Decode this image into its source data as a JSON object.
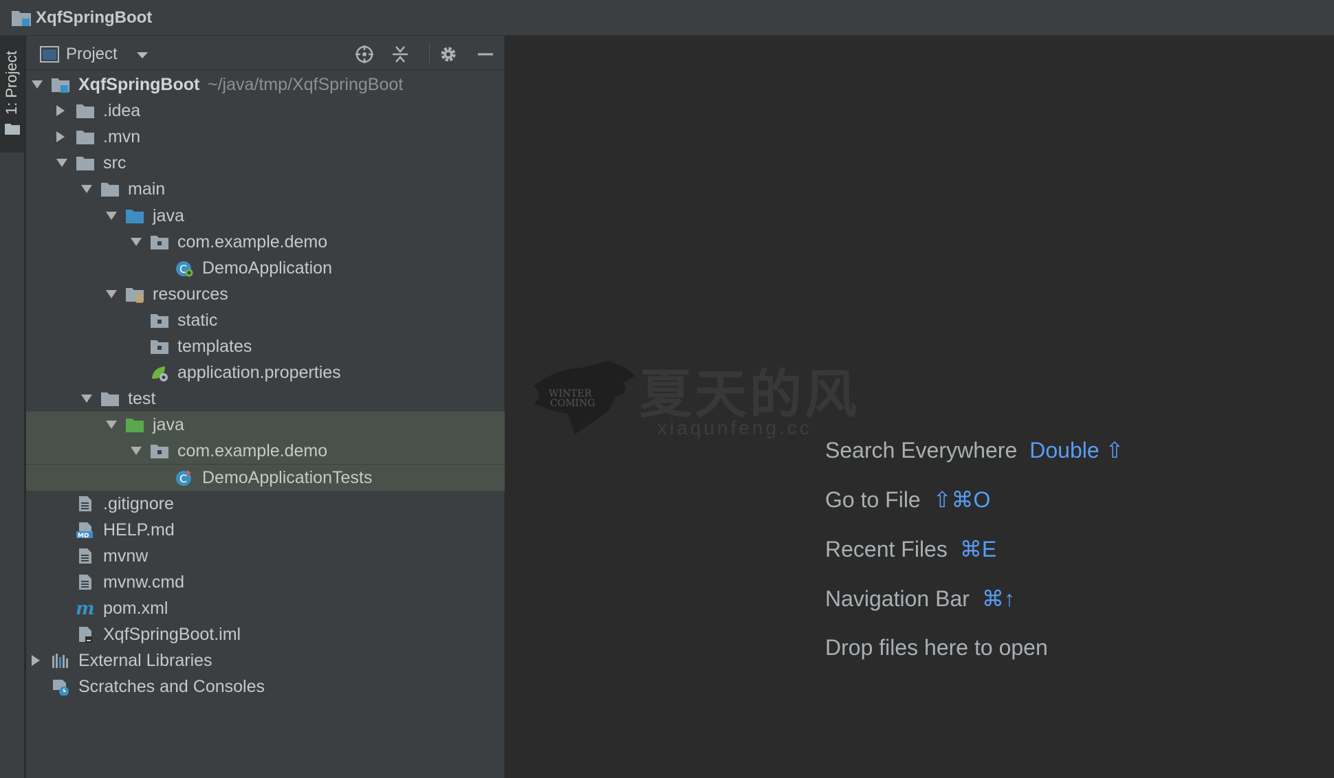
{
  "window": {
    "title": "XqfSpringBoot"
  },
  "side_strip": {
    "tab_label": "1: Project"
  },
  "panel": {
    "view_label": "Project"
  },
  "tree": [
    {
      "label": "XqfSpringBoot",
      "path": "~/java/tmp/XqfSpringBoot",
      "icon": "module-folder-icon",
      "arrow": "down",
      "depth": 0
    },
    {
      "label": ".idea",
      "icon": "folder-icon",
      "arrow": "right",
      "depth": 1
    },
    {
      "label": ".mvn",
      "icon": "folder-icon",
      "arrow": "right",
      "depth": 1
    },
    {
      "label": "src",
      "icon": "folder-icon",
      "arrow": "down",
      "depth": 1
    },
    {
      "label": "main",
      "icon": "folder-icon",
      "arrow": "down",
      "depth": 2
    },
    {
      "label": "java",
      "icon": "source-folder-icon",
      "arrow": "down",
      "depth": 3
    },
    {
      "label": "com.example.demo",
      "icon": "package-icon",
      "arrow": "down",
      "depth": 4
    },
    {
      "label": "DemoApplication",
      "icon": "spring-class-icon",
      "arrow": "none",
      "depth": 5
    },
    {
      "label": "resources",
      "icon": "resources-folder-icon",
      "arrow": "down",
      "depth": 3
    },
    {
      "label": "static",
      "icon": "package-icon",
      "arrow": "none",
      "depth": 4
    },
    {
      "label": "templates",
      "icon": "package-icon",
      "arrow": "none",
      "depth": 4
    },
    {
      "label": "application.properties",
      "icon": "spring-properties-icon",
      "arrow": "none",
      "depth": 4
    },
    {
      "label": "test",
      "icon": "folder-icon",
      "arrow": "down",
      "depth": 2
    },
    {
      "label": "java",
      "icon": "test-folder-icon",
      "arrow": "down",
      "depth": 3,
      "selected": true
    },
    {
      "label": "com.example.demo",
      "icon": "package-icon",
      "arrow": "down",
      "depth": 4,
      "selected": true
    },
    {
      "label": "DemoApplicationTests",
      "icon": "test-class-icon",
      "arrow": "none",
      "depth": 5,
      "selected": true
    },
    {
      "label": ".gitignore",
      "icon": "text-file-icon",
      "arrow": "none",
      "depth": 1
    },
    {
      "label": "HELP.md",
      "icon": "markdown-file-icon",
      "arrow": "none",
      "depth": 1
    },
    {
      "label": "mvnw",
      "icon": "text-file-icon",
      "arrow": "none",
      "depth": 1
    },
    {
      "label": "mvnw.cmd",
      "icon": "text-file-icon",
      "arrow": "none",
      "depth": 1
    },
    {
      "label": "pom.xml",
      "icon": "maven-icon",
      "arrow": "none",
      "depth": 1
    },
    {
      "label": "XqfSpringBoot.iml",
      "icon": "iml-file-icon",
      "arrow": "none",
      "depth": 1
    },
    {
      "label": "External Libraries",
      "icon": "libraries-icon",
      "arrow": "right",
      "depth": 0
    },
    {
      "label": "Scratches and Consoles",
      "icon": "scratches-icon",
      "arrow": "none",
      "depth": 0
    }
  ],
  "editor": {
    "hints": [
      {
        "label": "Search Everywhere",
        "key": "Double ⇧"
      },
      {
        "label": "Go to File",
        "key": "⇧⌘O"
      },
      {
        "label": "Recent Files",
        "key": "⌘E"
      },
      {
        "label": "Navigation Bar",
        "key": "⌘↑"
      },
      {
        "label": "Drop files here to open",
        "key": ""
      }
    ]
  },
  "watermark": {
    "cn": "夏天的风",
    "url": "xiaqunfeng.cc",
    "badge_line1": "WINTER",
    "badge_line2": "COMING"
  },
  "colors": {
    "accent": "#589df6",
    "selection": "#49524a",
    "panel": "#3c3f41",
    "editor": "#2b2b2b"
  }
}
